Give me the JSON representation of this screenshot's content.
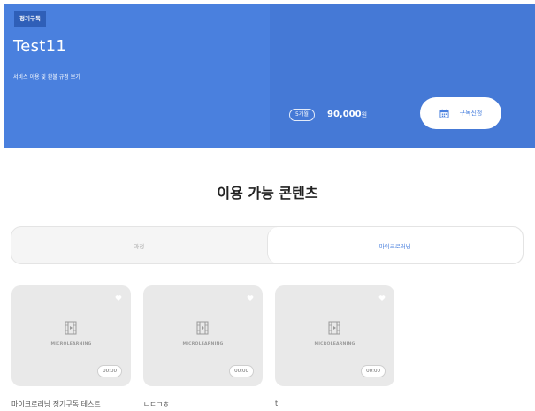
{
  "hero": {
    "badge": "정기구독",
    "title": "Test11",
    "policy_link": "서비스 이용 및 환불 규정 보기",
    "period": "5개월",
    "price": "90,000",
    "price_unit": "원",
    "subscribe_label": "구독신청",
    "accent_color": "#4a80de"
  },
  "section": {
    "title": "이용 가능 콘텐츠"
  },
  "tabs": [
    {
      "label": "과정",
      "active": false
    },
    {
      "label": "마이크로러닝",
      "active": true
    }
  ],
  "cards": [
    {
      "label": "MICROLEARNING",
      "duration": "00:00",
      "title": "마이크로러닝 정기구독 테스트",
      "icon": "film-icon"
    },
    {
      "label": "MICROLEARNING",
      "duration": "00:00",
      "title": "ㄴㄷㄱㅎ",
      "icon": "film-icon"
    },
    {
      "label": "MICROLEARNING",
      "duration": "00:00",
      "title": "t",
      "icon": "film-icon"
    }
  ]
}
